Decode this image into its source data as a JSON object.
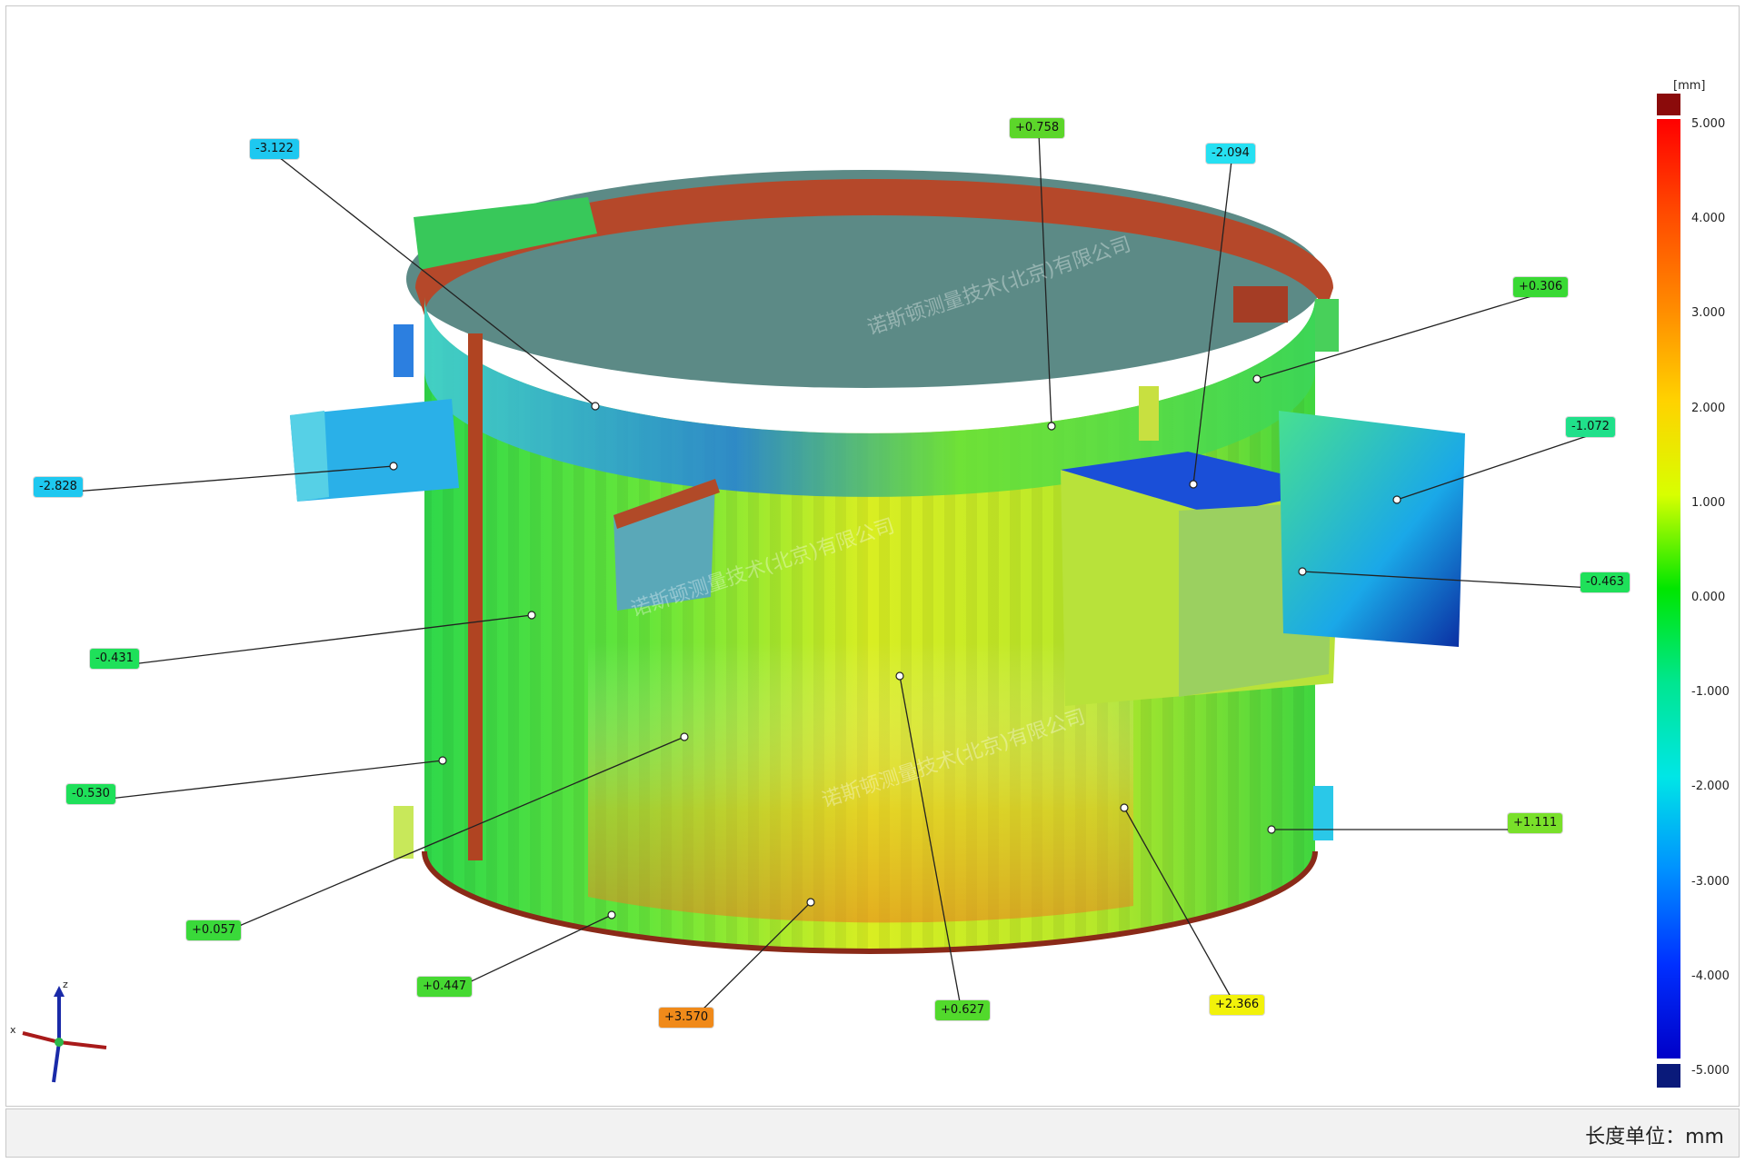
{
  "legend": {
    "unit": "[mm]",
    "ticks": [
      "5.000",
      "4.000",
      "3.000",
      "2.000",
      "1.000",
      "0.000",
      "-1.000",
      "-2.000",
      "-3.000",
      "-4.000",
      "-5.000"
    ]
  },
  "callouts": [
    {
      "label": "-3.122",
      "color": "#1ec8f0"
    },
    {
      "label": "+0.758",
      "color": "#5cd62a"
    },
    {
      "label": "-2.094",
      "color": "#26e0f2"
    },
    {
      "label": "+0.306",
      "color": "#39d934"
    },
    {
      "label": "-2.828",
      "color": "#1ec8f0"
    },
    {
      "label": "-1.072",
      "color": "#20e08a"
    },
    {
      "label": "-0.463",
      "color": "#1fe05a"
    },
    {
      "label": "-0.431",
      "color": "#1fe05a"
    },
    {
      "label": "-0.530",
      "color": "#1fe05a"
    },
    {
      "label": "+1.111",
      "color": "#79e02a"
    },
    {
      "label": "+0.057",
      "color": "#3ad93a"
    },
    {
      "label": "+0.447",
      "color": "#46d932"
    },
    {
      "label": "+3.570",
      "color": "#f08a1a"
    },
    {
      "label": "+0.627",
      "color": "#52d92c"
    },
    {
      "label": "+2.366",
      "color": "#f2f20a"
    }
  ],
  "axes": {
    "x": "x",
    "z": "z"
  },
  "watermark": "诺斯顿测量技术(北京)有限公司",
  "status_bar": {
    "units_label": "长度单位：mm"
  }
}
